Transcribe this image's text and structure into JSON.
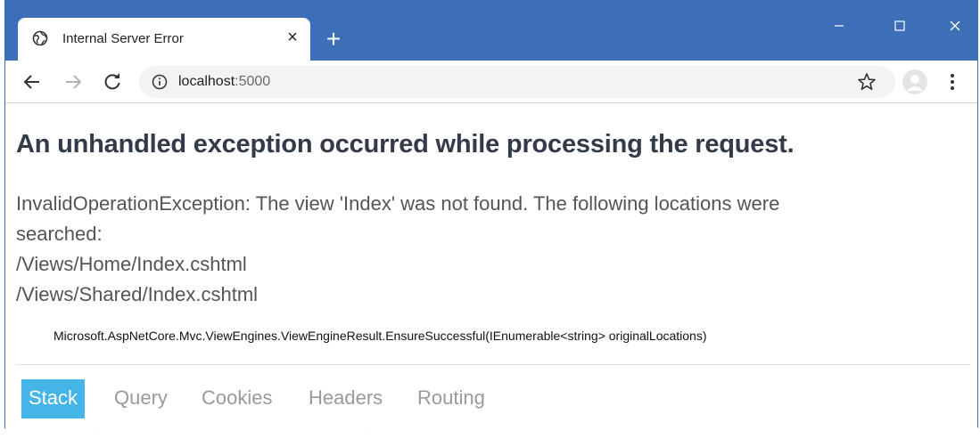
{
  "browser": {
    "tab_title": "Internal Server Error",
    "tab_close": "×",
    "new_tab": "+",
    "url_host": "localhost",
    "url_port": ":5000"
  },
  "page": {
    "heading": "An unhandled exception occurred while processing the request.",
    "message_lines": [
      "InvalidOperationException: The view 'Index' was not found. The following locations were",
      "searched:",
      "/Views/Home/Index.cshtml",
      "/Views/Shared/Index.cshtml"
    ],
    "stack_method": "Microsoft.AspNetCore.Mvc.ViewEngines.ViewEngineResult.EnsureSuccessful(IEnumerable<string> originalLocations)",
    "tabs": [
      "Stack",
      "Query",
      "Cookies",
      "Headers",
      "Routing"
    ]
  },
  "colors": {
    "titlebar": "#3c6fb8",
    "active_tab": "#44b5e6",
    "heading": "#333b48"
  },
  "icons": {
    "tab": "globe-icon",
    "back": "back-arrow-icon",
    "forward": "forward-arrow-icon",
    "reload": "reload-icon",
    "info": "info-icon",
    "bookmark": "star-icon",
    "profile": "profile-icon",
    "menu": "kebab-menu-icon"
  }
}
